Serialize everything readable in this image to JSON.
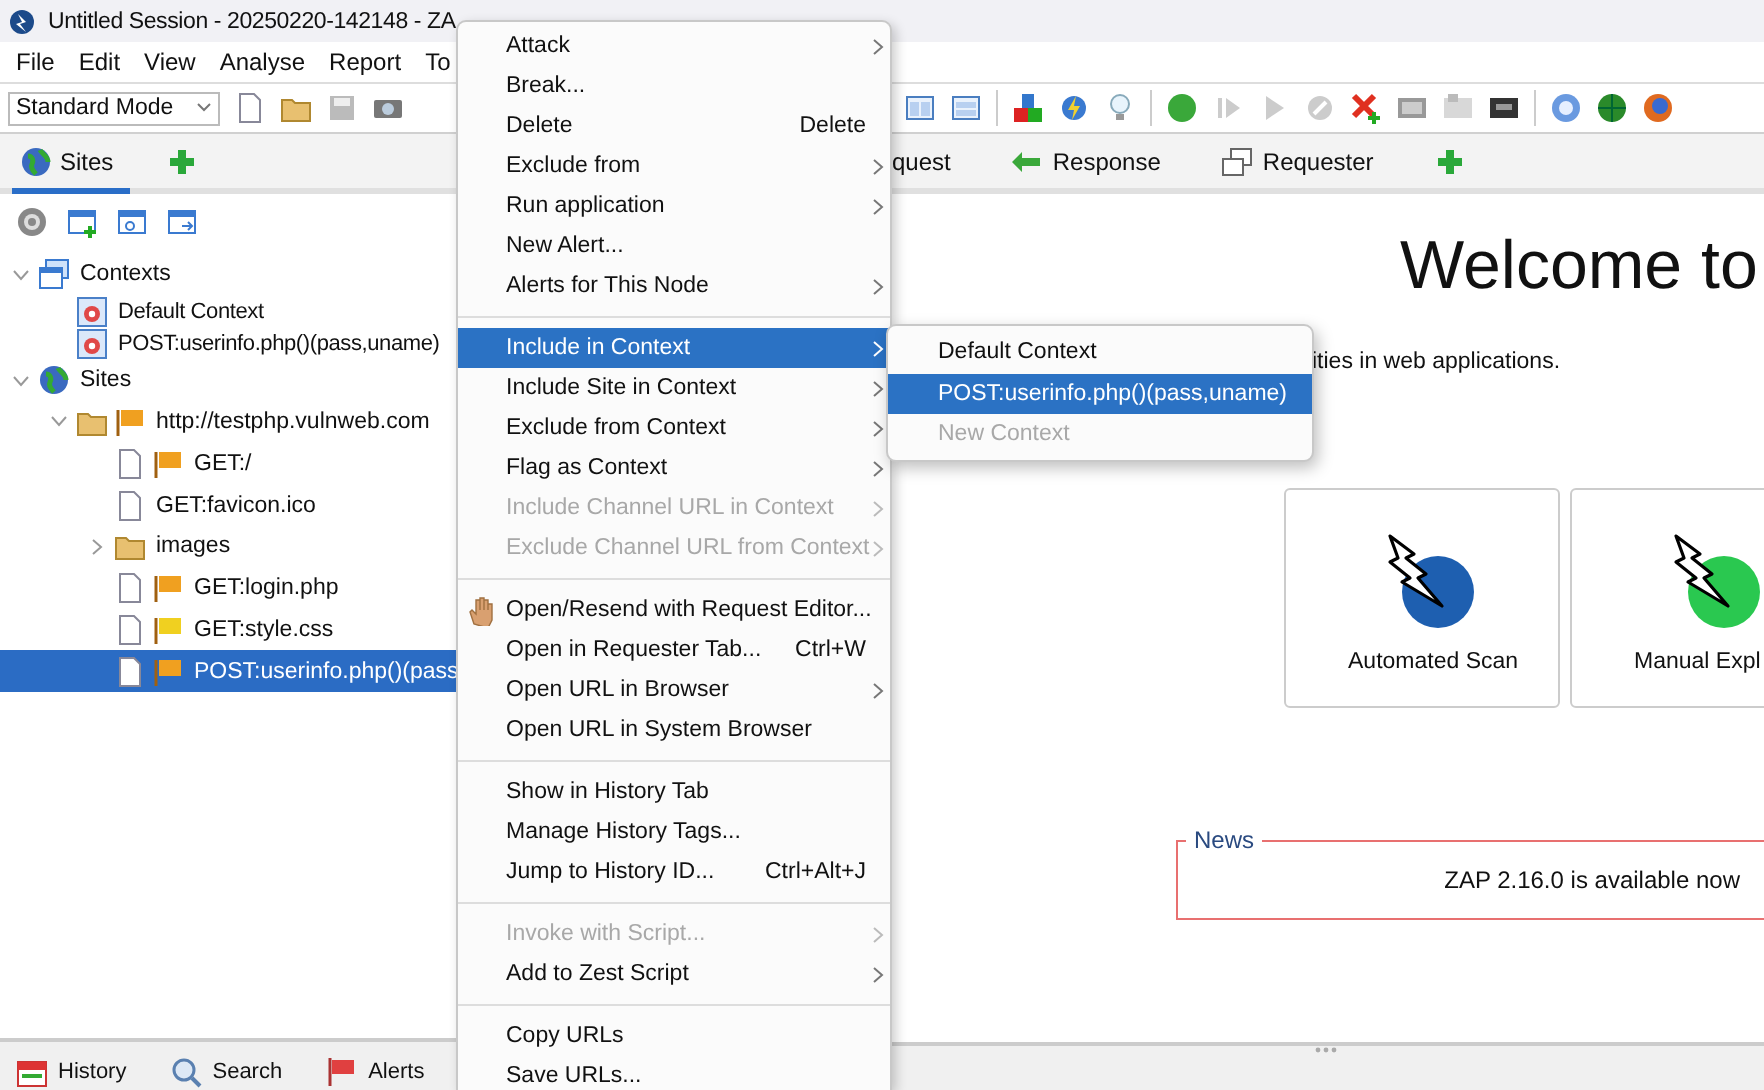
{
  "window": {
    "title": "Untitled Session - 20250220-142148 - ZA"
  },
  "menu_bar": [
    "File",
    "Edit",
    "View",
    "Analyse",
    "Report",
    "To"
  ],
  "toolbar": {
    "mode": "Standard Mode"
  },
  "sites_pane": {
    "tabs": [
      {
        "label": "Sites",
        "selected": true
      }
    ],
    "tree": [
      {
        "label": "Contexts",
        "kind": "contexts",
        "expanded": true,
        "selected": false,
        "children": [
          {
            "label": "Default Context",
            "kind": "context",
            "selected": false
          },
          {
            "label": "POST:userinfo.php()(pass,uname)",
            "kind": "context",
            "selected": false
          }
        ]
      },
      {
        "label": "Sites",
        "kind": "sites",
        "expanded": true,
        "selected": false,
        "children": [
          {
            "label": "http://testphp.vulnweb.com",
            "kind": "folder",
            "color": "#f0a020",
            "expanded": true,
            "selected": false,
            "children": [
              {
                "label": "GET:/",
                "kind": "page",
                "color": "#f0a020",
                "selected": false
              },
              {
                "label": "GET:favicon.ico",
                "kind": "page",
                "selected": false
              },
              {
                "label": "images",
                "kind": "folder",
                "expanded": false,
                "selected": false
              },
              {
                "label": "GET:login.php",
                "kind": "page",
                "color": "#f0a020",
                "selected": false
              },
              {
                "label": "GET:style.css",
                "kind": "page",
                "color": "#f0d020",
                "selected": false
              },
              {
                "label": "POST:userinfo.php()(pass",
                "kind": "page",
                "color": "#f0a020",
                "selected": true
              }
            ]
          }
        ]
      }
    ]
  },
  "work_pane": {
    "tabs": [
      {
        "label": "quest",
        "selected": false
      },
      {
        "label": "Response",
        "selected": false
      },
      {
        "label": "Requester",
        "selected": false
      }
    ],
    "heading": "Welcome to",
    "intro": "ities in web applications.",
    "cards": [
      {
        "label": "Automated Scan",
        "kind": "automated"
      },
      {
        "label": "Manual Expl",
        "kind": "manual"
      }
    ],
    "news": {
      "title": "News",
      "text": "ZAP 2.16.0 is available now"
    }
  },
  "bottom_tabs": [
    "History",
    "Search",
    "Alerts"
  ],
  "context_menu": [
    {
      "kind": "item",
      "label": "Attack",
      "submenu": true,
      "disabled": false,
      "selected": false
    },
    {
      "kind": "item",
      "label": "Break...",
      "submenu": false,
      "disabled": false,
      "selected": false
    },
    {
      "kind": "item",
      "label": "Delete",
      "shortcut": "Delete",
      "submenu": false,
      "disabled": false,
      "selected": false
    },
    {
      "kind": "item",
      "label": "Exclude from",
      "submenu": true,
      "disabled": false,
      "selected": false
    },
    {
      "kind": "item",
      "label": "Run application",
      "submenu": true,
      "disabled": false,
      "selected": false
    },
    {
      "kind": "item",
      "label": "New Alert...",
      "submenu": false,
      "disabled": false,
      "selected": false
    },
    {
      "kind": "item",
      "label": "Alerts for This Node",
      "submenu": true,
      "disabled": false,
      "selected": false
    },
    {
      "kind": "separator"
    },
    {
      "kind": "item",
      "label": "Include in Context",
      "submenu": true,
      "disabled": false,
      "selected": true
    },
    {
      "kind": "item",
      "label": "Include Site in Context",
      "submenu": true,
      "disabled": false,
      "selected": false
    },
    {
      "kind": "item",
      "label": "Exclude from Context",
      "submenu": true,
      "disabled": false,
      "selected": false
    },
    {
      "kind": "item",
      "label": "Flag as Context",
      "submenu": true,
      "disabled": false,
      "selected": false
    },
    {
      "kind": "item",
      "label": "Include Channel URL in Context",
      "submenu": true,
      "disabled": true,
      "selected": false
    },
    {
      "kind": "item",
      "label": "Exclude Channel URL from Context",
      "submenu": true,
      "disabled": true,
      "selected": false
    },
    {
      "kind": "separator"
    },
    {
      "kind": "tool",
      "label": "Open/Resend with Request Editor...",
      "submenu": false,
      "disabled": false,
      "selected": false
    },
    {
      "kind": "item",
      "label": "Open in Requester Tab...",
      "shortcut": "Ctrl+W",
      "submenu": false,
      "disabled": false,
      "selected": false
    },
    {
      "kind": "item",
      "label": "Open URL in Browser",
      "submenu": true,
      "disabled": false,
      "selected": false
    },
    {
      "kind": "item",
      "label": "Open URL in System Browser",
      "submenu": false,
      "disabled": false,
      "selected": false
    },
    {
      "kind": "separator"
    },
    {
      "kind": "item",
      "label": "Show in History Tab",
      "submenu": false,
      "disabled": false,
      "selected": false
    },
    {
      "kind": "item",
      "label": "Manage History Tags...",
      "submenu": false,
      "disabled": false,
      "selected": false
    },
    {
      "kind": "item",
      "label": "Jump to History ID...",
      "shortcut": "Ctrl+Alt+J",
      "submenu": false,
      "disabled": false,
      "selected": false
    },
    {
      "kind": "separator"
    },
    {
      "kind": "item",
      "label": "Invoke with Script...",
      "submenu": true,
      "disabled": true,
      "selected": false
    },
    {
      "kind": "item",
      "label": "Add to Zest Script",
      "submenu": true,
      "disabled": false,
      "selected": false
    },
    {
      "kind": "separator"
    },
    {
      "kind": "item",
      "label": "Copy URLs",
      "submenu": false,
      "disabled": false,
      "selected": false
    },
    {
      "kind": "item",
      "label": "Save URLs...",
      "submenu": false,
      "disabled": false,
      "selected": false
    }
  ],
  "submenu": [
    {
      "label": "Default Context",
      "disabled": false,
      "selected": false
    },
    {
      "label": "POST:userinfo.php()(pass,uname)",
      "disabled": false,
      "selected": true
    },
    {
      "label": "New Context",
      "disabled": true,
      "selected": false
    }
  ]
}
